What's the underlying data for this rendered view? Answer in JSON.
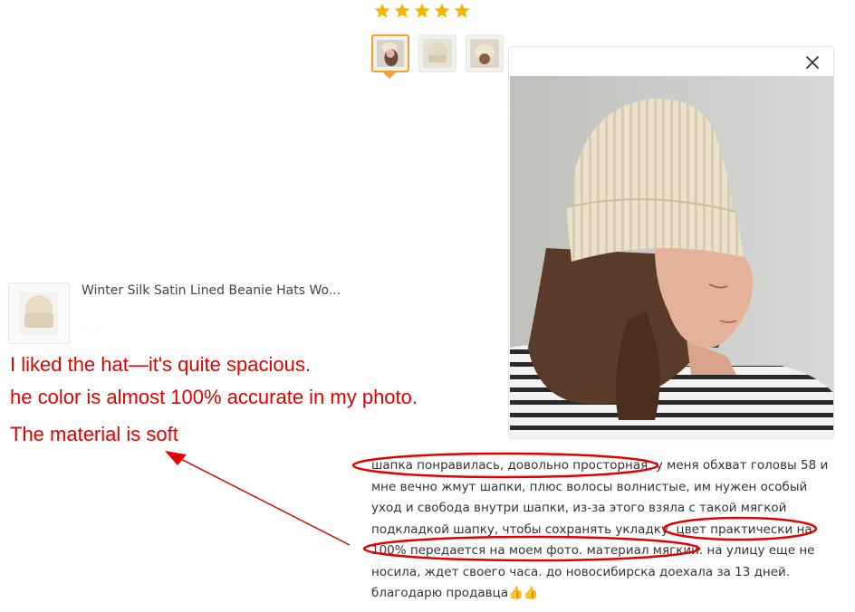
{
  "rating": {
    "stars": 5,
    "star_color": "#f5b400"
  },
  "thumbnails": [
    {
      "name": "thumb-photo-1",
      "active": true
    },
    {
      "name": "thumb-photo-2",
      "active": false
    },
    {
      "name": "thumb-photo-3",
      "active": false
    }
  ],
  "preview": {
    "close_icon": "close-icon"
  },
  "product": {
    "title": "Winter Silk Satin Lined Beanie Hats Wo...",
    "faint_text": "· · ·"
  },
  "annotations": {
    "color": "#e30000",
    "line1": "I liked the hat—it's quite spacious.",
    "line2": "he color is almost 100% accurate in my photo.",
    "line3": "The material is soft"
  },
  "review": {
    "lines": [
      "шапка понравилась, довольно просторная. у меня обхват головы 58 и",
      "мне вечно жмут шапки, плюс волосы волнистые, им нужен особый",
      "уход и свобода внутри шапки, из-за этого взяла с такой мягкой",
      "подкладкой шапку, чтобы сохранять укладку. цвет практически на",
      "100% передается на моем фото. материал мягкий. на улицу еще не",
      "носила, ждет своего часа. до новосибирска доехала за 13 дней.",
      "благодарю продавца👍👍"
    ]
  }
}
